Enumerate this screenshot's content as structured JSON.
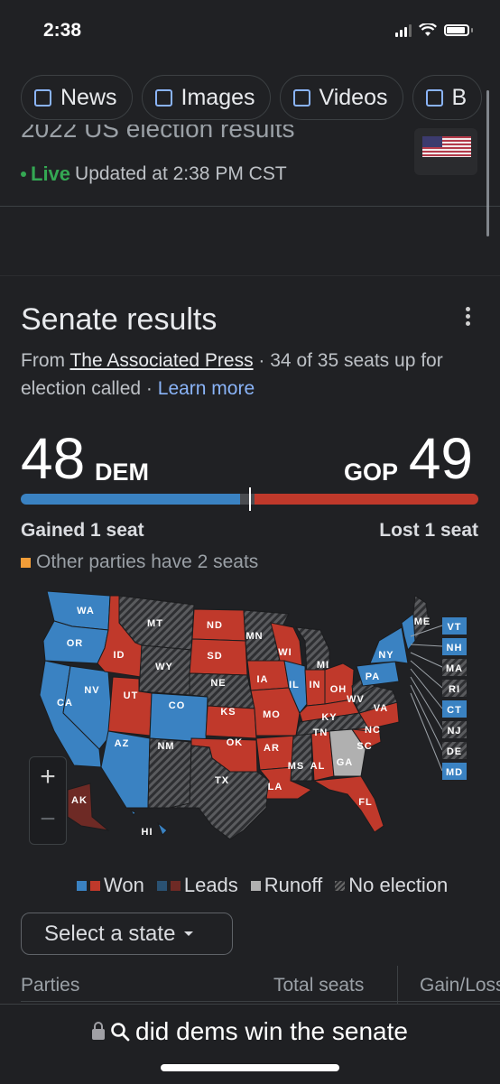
{
  "status_bar": {
    "time": "2:38"
  },
  "chips": [
    {
      "label": "News",
      "icon": "news-icon"
    },
    {
      "label": "Images",
      "icon": "image-icon"
    },
    {
      "label": "Videos",
      "icon": "play-icon"
    },
    {
      "label": "B",
      "icon": "book-icon"
    }
  ],
  "header": {
    "title_partial": "2022 US election results",
    "live_label": "Live",
    "updated": "Updated at 2:38 PM CST"
  },
  "card": {
    "title": "Senate results",
    "source_prefix": "From",
    "source_link": "The Associated Press",
    "source_suffix": "· 34 of 35 seats up for election called ·",
    "learn_more": "Learn more"
  },
  "tally": {
    "dem_seats": "48",
    "dem_label": "DEM",
    "gop_seats": "49",
    "gop_label": "GOP",
    "dem_change": "Gained 1 seat",
    "gop_change": "Lost 1 seat",
    "other_note": "Other parties have 2 seats",
    "bar": {
      "dem": 48,
      "other": 3,
      "gop": 49
    },
    "colors": {
      "dem": "#3a82c2",
      "gop": "#c0392b",
      "other": "#f29d38"
    }
  },
  "map": {
    "states_won_dem": [
      "WA",
      "OR",
      "CA",
      "NV",
      "AZ",
      "CO",
      "IL",
      "NY",
      "PA",
      "VT",
      "NH",
      "CT",
      "MD",
      "HI"
    ],
    "states_won_gop": [
      "ID",
      "UT",
      "ND",
      "SD",
      "KS",
      "OK",
      "IA",
      "MO",
      "AR",
      "WI",
      "IN",
      "OH",
      "KY",
      "NC",
      "SC",
      "AL",
      "LA",
      "FL"
    ],
    "states_leads_gop": [
      "AK"
    ],
    "states_runoff": [
      "GA"
    ],
    "states_no_election": [
      "MT",
      "WY",
      "NE",
      "MN",
      "MI",
      "NM",
      "TX",
      "TN",
      "MS",
      "WV",
      "VA",
      "ME",
      "MA",
      "RI",
      "NJ",
      "DE"
    ],
    "labels": [
      "WA",
      "OR",
      "CA",
      "NV",
      "ID",
      "MT",
      "WY",
      "UT",
      "CO",
      "AZ",
      "NM",
      "ND",
      "SD",
      "NE",
      "KS",
      "OK",
      "TX",
      "MN",
      "IA",
      "MO",
      "AR",
      "LA",
      "WI",
      "IL",
      "MI",
      "IN",
      "OH",
      "KY",
      "TN",
      "MS",
      "AL",
      "GA",
      "FL",
      "SC",
      "NC",
      "VA",
      "WV",
      "PA",
      "NY",
      "ME",
      "AK",
      "HI"
    ],
    "callouts": [
      {
        "state": "VT",
        "status": "dem"
      },
      {
        "state": "NH",
        "status": "dem"
      },
      {
        "state": "MA",
        "status": "none"
      },
      {
        "state": "RI",
        "status": "none"
      },
      {
        "state": "CT",
        "status": "dem"
      },
      {
        "state": "NJ",
        "status": "none"
      },
      {
        "state": "DE",
        "status": "none"
      },
      {
        "state": "MD",
        "status": "dem"
      }
    ]
  },
  "legend": {
    "won": "Won",
    "leads": "Leads",
    "runoff": "Runoff",
    "no_election": "No election"
  },
  "select_state": "Select a state",
  "table": {
    "headers": [
      "Parties",
      "Total seats",
      "Gain/Loss"
    ]
  },
  "url_bar": {
    "query": "did dems win the senate"
  }
}
